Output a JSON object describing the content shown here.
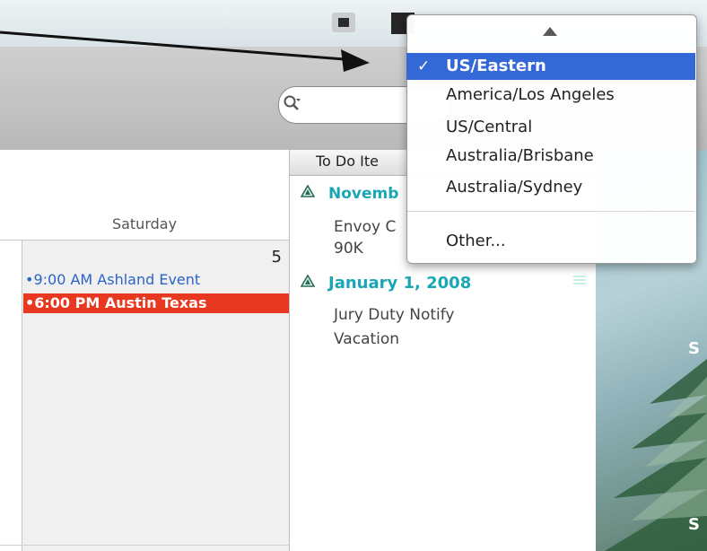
{
  "calendar": {
    "day_name": "Saturday",
    "day_number": "5",
    "events": [
      {
        "label": "•9:00 AM Ashland Event",
        "color": "#2c63c9"
      },
      {
        "label": "•6:00 PM Austin Texas",
        "color": "#e8381f"
      }
    ]
  },
  "todo": {
    "header": "To Do Ite",
    "items": [
      {
        "date": "Novemb",
        "notes": [
          "Envoy C",
          "90K"
        ]
      },
      {
        "date": "January 1, 2008",
        "notes": [
          "Jury Duty Notify",
          "Vacation"
        ]
      }
    ]
  },
  "timezone_menu": {
    "up_icon": "triangle-up-icon",
    "selected_check": "✓",
    "items": [
      {
        "label": "US/Eastern",
        "selected": true
      },
      {
        "label": "America/Los Angeles",
        "selected": false
      },
      {
        "label": "US/Central",
        "selected": false
      },
      {
        "label": "Australia/Brisbane",
        "selected": false
      },
      {
        "label": "Australia/Sydney",
        "selected": false
      },
      {
        "label": "Other...",
        "selected": false
      }
    ]
  },
  "search": {
    "icon": "search-icon"
  },
  "photo_captions": [
    "S",
    "S"
  ],
  "colors": {
    "accent_selected": "#3468d7",
    "event_red": "#e8381f",
    "event_blue": "#2c63c9",
    "todo_date": "#1aa6b5"
  }
}
